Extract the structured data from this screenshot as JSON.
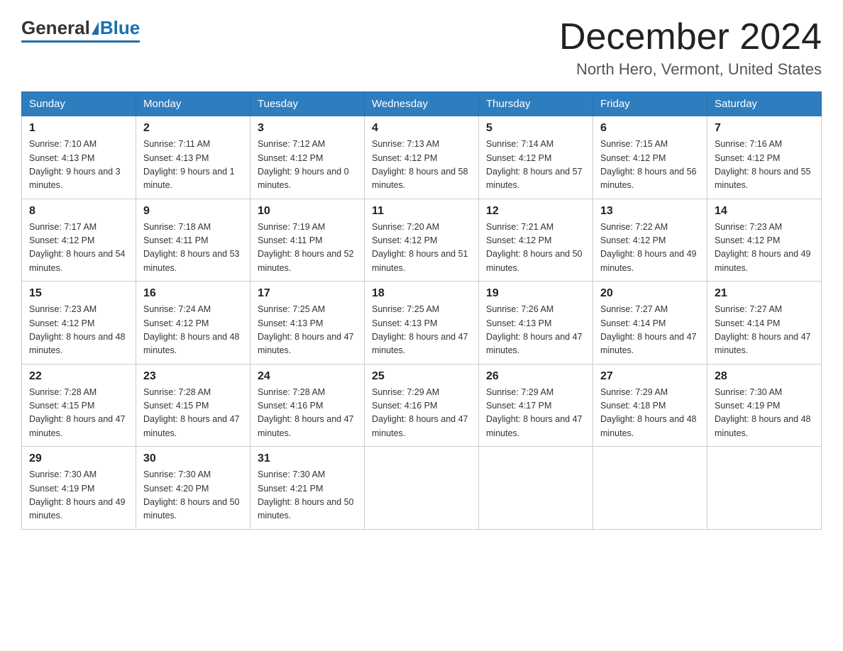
{
  "logo": {
    "general": "General",
    "blue": "Blue"
  },
  "header": {
    "month": "December 2024",
    "location": "North Hero, Vermont, United States"
  },
  "weekdays": [
    "Sunday",
    "Monday",
    "Tuesday",
    "Wednesday",
    "Thursday",
    "Friday",
    "Saturday"
  ],
  "weeks": [
    [
      {
        "day": "1",
        "sunrise": "7:10 AM",
        "sunset": "4:13 PM",
        "daylight": "9 hours and 3 minutes."
      },
      {
        "day": "2",
        "sunrise": "7:11 AM",
        "sunset": "4:13 PM",
        "daylight": "9 hours and 1 minute."
      },
      {
        "day": "3",
        "sunrise": "7:12 AM",
        "sunset": "4:12 PM",
        "daylight": "9 hours and 0 minutes."
      },
      {
        "day": "4",
        "sunrise": "7:13 AM",
        "sunset": "4:12 PM",
        "daylight": "8 hours and 58 minutes."
      },
      {
        "day": "5",
        "sunrise": "7:14 AM",
        "sunset": "4:12 PM",
        "daylight": "8 hours and 57 minutes."
      },
      {
        "day": "6",
        "sunrise": "7:15 AM",
        "sunset": "4:12 PM",
        "daylight": "8 hours and 56 minutes."
      },
      {
        "day": "7",
        "sunrise": "7:16 AM",
        "sunset": "4:12 PM",
        "daylight": "8 hours and 55 minutes."
      }
    ],
    [
      {
        "day": "8",
        "sunrise": "7:17 AM",
        "sunset": "4:12 PM",
        "daylight": "8 hours and 54 minutes."
      },
      {
        "day": "9",
        "sunrise": "7:18 AM",
        "sunset": "4:11 PM",
        "daylight": "8 hours and 53 minutes."
      },
      {
        "day": "10",
        "sunrise": "7:19 AM",
        "sunset": "4:11 PM",
        "daylight": "8 hours and 52 minutes."
      },
      {
        "day": "11",
        "sunrise": "7:20 AM",
        "sunset": "4:12 PM",
        "daylight": "8 hours and 51 minutes."
      },
      {
        "day": "12",
        "sunrise": "7:21 AM",
        "sunset": "4:12 PM",
        "daylight": "8 hours and 50 minutes."
      },
      {
        "day": "13",
        "sunrise": "7:22 AM",
        "sunset": "4:12 PM",
        "daylight": "8 hours and 49 minutes."
      },
      {
        "day": "14",
        "sunrise": "7:23 AM",
        "sunset": "4:12 PM",
        "daylight": "8 hours and 49 minutes."
      }
    ],
    [
      {
        "day": "15",
        "sunrise": "7:23 AM",
        "sunset": "4:12 PM",
        "daylight": "8 hours and 48 minutes."
      },
      {
        "day": "16",
        "sunrise": "7:24 AM",
        "sunset": "4:12 PM",
        "daylight": "8 hours and 48 minutes."
      },
      {
        "day": "17",
        "sunrise": "7:25 AM",
        "sunset": "4:13 PM",
        "daylight": "8 hours and 47 minutes."
      },
      {
        "day": "18",
        "sunrise": "7:25 AM",
        "sunset": "4:13 PM",
        "daylight": "8 hours and 47 minutes."
      },
      {
        "day": "19",
        "sunrise": "7:26 AM",
        "sunset": "4:13 PM",
        "daylight": "8 hours and 47 minutes."
      },
      {
        "day": "20",
        "sunrise": "7:27 AM",
        "sunset": "4:14 PM",
        "daylight": "8 hours and 47 minutes."
      },
      {
        "day": "21",
        "sunrise": "7:27 AM",
        "sunset": "4:14 PM",
        "daylight": "8 hours and 47 minutes."
      }
    ],
    [
      {
        "day": "22",
        "sunrise": "7:28 AM",
        "sunset": "4:15 PM",
        "daylight": "8 hours and 47 minutes."
      },
      {
        "day": "23",
        "sunrise": "7:28 AM",
        "sunset": "4:15 PM",
        "daylight": "8 hours and 47 minutes."
      },
      {
        "day": "24",
        "sunrise": "7:28 AM",
        "sunset": "4:16 PM",
        "daylight": "8 hours and 47 minutes."
      },
      {
        "day": "25",
        "sunrise": "7:29 AM",
        "sunset": "4:16 PM",
        "daylight": "8 hours and 47 minutes."
      },
      {
        "day": "26",
        "sunrise": "7:29 AM",
        "sunset": "4:17 PM",
        "daylight": "8 hours and 47 minutes."
      },
      {
        "day": "27",
        "sunrise": "7:29 AM",
        "sunset": "4:18 PM",
        "daylight": "8 hours and 48 minutes."
      },
      {
        "day": "28",
        "sunrise": "7:30 AM",
        "sunset": "4:19 PM",
        "daylight": "8 hours and 48 minutes."
      }
    ],
    [
      {
        "day": "29",
        "sunrise": "7:30 AM",
        "sunset": "4:19 PM",
        "daylight": "8 hours and 49 minutes."
      },
      {
        "day": "30",
        "sunrise": "7:30 AM",
        "sunset": "4:20 PM",
        "daylight": "8 hours and 50 minutes."
      },
      {
        "day": "31",
        "sunrise": "7:30 AM",
        "sunset": "4:21 PM",
        "daylight": "8 hours and 50 minutes."
      },
      null,
      null,
      null,
      null
    ]
  ],
  "labels": {
    "sunrise": "Sunrise:",
    "sunset": "Sunset:",
    "daylight": "Daylight:"
  }
}
